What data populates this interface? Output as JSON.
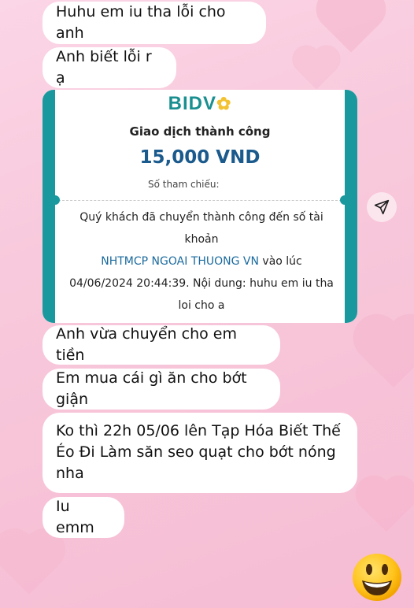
{
  "messages": [
    "Huhu em iu tha lỗi cho anh",
    "Anh biết lỗi r ạ",
    "Anh vừa chuyển cho em tiền",
    "Em mua cái gì ăn cho bớt giận",
    "Ko thì 22h 05/06 lên Tạp Hóa Biết Thế Éo Đi Làm săn seo quạt cho bớt nóng nha",
    "Iu emm"
  ],
  "receipt": {
    "bank": "BIDV",
    "status": "Giao dịch thành công",
    "amount": "15,000 VND",
    "ref_label": "Số tham chiếu:",
    "line1": "Quý khách đã chuyển thành công đến số tài khoản",
    "bank_name": "NHTMCP NGOAI THUONG VN",
    "line2": "vào lúc 04/06/2024 20:44:39. Nội dung: huhu em iu tha loi cho a",
    "accent": "#19999e"
  },
  "icons": {
    "share": "send-arrow-icon",
    "reaction": "smiling-face-emoji"
  },
  "colors": {
    "background": "#f8c9dc",
    "bubble": "#ffffff",
    "bank_brand": "#1a8f90",
    "amount": "#1a5a8c"
  }
}
